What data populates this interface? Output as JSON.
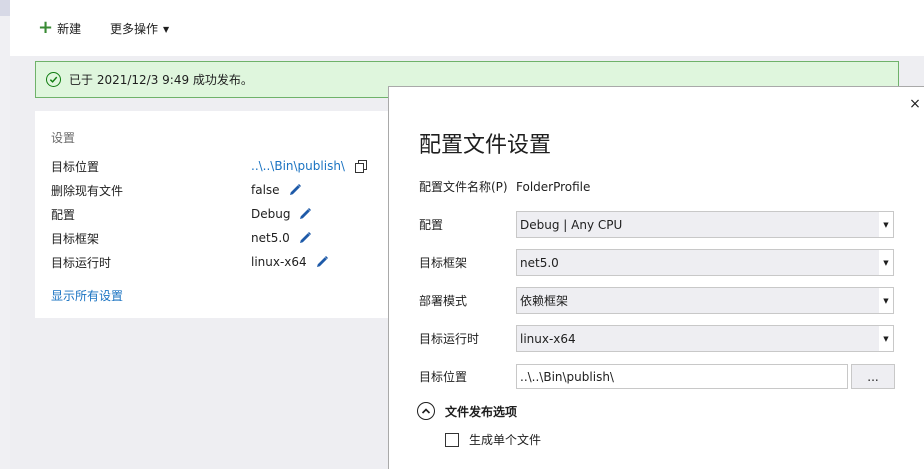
{
  "toolbar": {
    "new_label": "新建",
    "more_label": "更多操作"
  },
  "banner": {
    "message": "已于 2021/12/3 9:49 成功发布。"
  },
  "settings_summary": {
    "heading": "设置",
    "rows": [
      {
        "label": "目标位置",
        "value": "..\\..\\Bin\\publish\\"
      },
      {
        "label": "删除现有文件",
        "value": "false"
      },
      {
        "label": "配置",
        "value": "Debug"
      },
      {
        "label": "目标框架",
        "value": "net5.0"
      },
      {
        "label": "目标运行时",
        "value": "linux-x64"
      }
    ],
    "show_all_label": "显示所有设置"
  },
  "dialog": {
    "title": "配置文件设置",
    "close_label": "×",
    "profile_name_label": "配置文件名称(P)",
    "profile_name_value": "FolderProfile",
    "configuration": {
      "label": "配置",
      "value": "Debug | Any CPU"
    },
    "target_framework": {
      "label": "目标框架",
      "value": "net5.0"
    },
    "deployment_mode": {
      "label": "部署模式",
      "value": "依赖框架"
    },
    "target_runtime": {
      "label": "目标运行时",
      "value": "linux-x64"
    },
    "target_location": {
      "label": "目标位置",
      "value": "..\\..\\Bin\\publish\\"
    },
    "browse_label": "...",
    "file_publish_options": {
      "title": "文件发布选项",
      "single_file_label": "生成单个文件"
    }
  },
  "colors": {
    "accent_link": "#1a73c2",
    "success_bg": "#dff6dd",
    "success_border": "#6fb26a",
    "success_icon": "#107c10",
    "add_icon": "#388a34"
  }
}
